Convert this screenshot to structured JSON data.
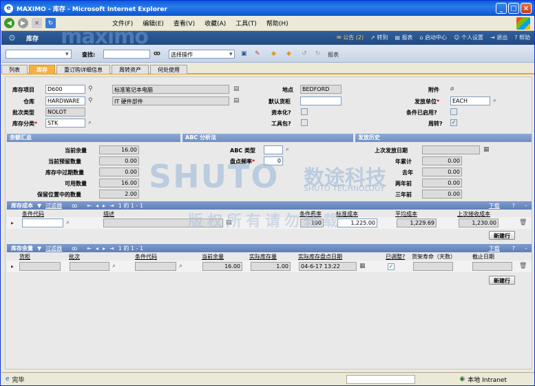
{
  "window": {
    "title": "MAXIMO - 库存 - Microsoft Internet Explorer",
    "controls": [
      "_",
      "□",
      "×"
    ]
  },
  "menu": {
    "items": [
      "文件(F)",
      "编辑(E)",
      "查看(V)",
      "收藏(A)",
      "工具(T)",
      "帮助(H)"
    ]
  },
  "banner": {
    "app_title": "库存",
    "logo": "maximo",
    "bulletin": "公告 (2)",
    "links": [
      "转到",
      "报表",
      "启动中心",
      "个人设置",
      "退出",
      "帮助"
    ]
  },
  "toolbar": {
    "find_label": "查找:",
    "action_select": "选择操作",
    "report_label": "报表"
  },
  "tabs": [
    "列表",
    "库存",
    "重订购详细信息",
    "周转资产",
    "何处使用"
  ],
  "header": {
    "item_label": "库存项目",
    "item_value": "D600",
    "item_desc": "标准笔记本电脑",
    "store_label": "仓库",
    "store_value": "HARDWARE",
    "store_desc": "IT 硬件部件",
    "lot_type_label": "批次类型",
    "lot_type_value": "NOLOT",
    "category_label": "库存分类",
    "category_value": "STK",
    "site_label": "地点",
    "site_value": "BEDFORD",
    "default_bin_label": "默认货柜",
    "default_bin_value": "",
    "capitalized_label": "资本化?",
    "kit_label": "工具包?",
    "attachments_label": "附件",
    "issue_unit_label": "发放单位",
    "issue_unit_value": "EACH",
    "condition_label": "条件已启用?",
    "rotating_label": "周转?"
  },
  "balance": {
    "section": "余额汇总",
    "current_label": "当前余量",
    "current_value": "16.00",
    "reserved_label": "当前预留数量",
    "reserved_value": "0.00",
    "expired_label": "库存中过期数量",
    "expired_value": "0.00",
    "available_label": "可用数量",
    "available_value": "16.00",
    "holding_label": "保留位置中的数量",
    "holding_value": "2.00"
  },
  "abc": {
    "section": "ABC 分析法",
    "type_label": "ABC 类型",
    "type_value": "",
    "freq_label": "盘点频率",
    "freq_value": "0"
  },
  "issue_history": {
    "section": "发放历史",
    "last_issue_label": "上次发放日期",
    "last_issue_value": "",
    "ytd_label": "年累计",
    "ytd_value": "0.00",
    "last_year_label": "去年",
    "last_year_value": "0.00",
    "two_years_label": "两年前",
    "two_years_value": "0.00",
    "three_years_label": "三年前",
    "three_years_value": "0.00"
  },
  "cost_grid": {
    "title": "库存成本",
    "filter": "过滤器",
    "pager": "1 的 1 - 1",
    "download": "下载",
    "columns": [
      "条件代码",
      "描述",
      "条件费率",
      "标准成本",
      "平均成本",
      "上次接收成本"
    ],
    "row": {
      "condition_code": "",
      "description": "",
      "rate": "100",
      "std_cost": "1,225.00",
      "avg_cost": "1,229.69",
      "last_cost": "1,230.00"
    },
    "new_row": "新建行"
  },
  "balance_grid": {
    "title": "库存余量",
    "filter": "过滤器",
    "pager": "1 的 1 - 1",
    "download": "下载",
    "columns": [
      "货柜",
      "批次",
      "条件代码",
      "当前余量",
      "实际库存量",
      "实际库存盘点日期",
      "已调整?",
      "货架寿命（天数）",
      "截止日期"
    ],
    "row": {
      "bin": "",
      "lot": "",
      "condition_code": "",
      "current": "16.00",
      "physical": "1.00",
      "count_date": "04-6-17 13:22",
      "shelf_life": "",
      "expiry": ""
    },
    "new_row": "新建行"
  },
  "watermark": {
    "brand": "SHUTO",
    "brand_cn": "数途科技",
    "brand_en": "SHUTO TECHNOLOGY",
    "copyright": "版权所有请勿转载"
  },
  "status": {
    "left": "完毕",
    "zone": "本地 Intranet"
  }
}
